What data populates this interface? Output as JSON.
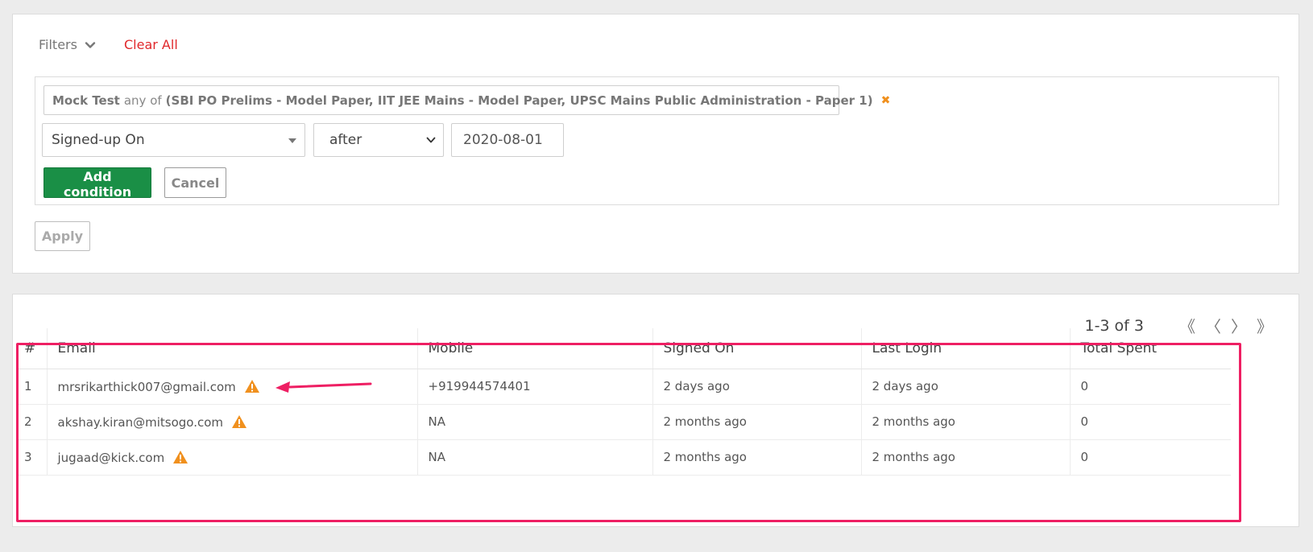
{
  "filters": {
    "toggle_label": "Filters",
    "clear_all_label": "Clear All",
    "condition_tag": {
      "field": "Mock Test",
      "operator": "any of",
      "values": "(SBI PO Prelims - Model Paper, IIT JEE Mains - Model Paper, UPSC Mains Public Administration - Paper 1)"
    },
    "new_condition": {
      "field": "Signed-up On",
      "operator": "after",
      "value": "2020-08-01"
    },
    "add_condition_label": "Add condition",
    "cancel_label": "Cancel",
    "apply_label": "Apply"
  },
  "pagination": {
    "info": "1-3 of 3",
    "first": "《",
    "prev": "〈",
    "next": "〉",
    "last": "》"
  },
  "table": {
    "headers": [
      "#",
      "Email",
      "Mobile",
      "Signed On",
      "Last Login",
      "Total Spent"
    ],
    "rows": [
      {
        "index": "1",
        "email": "mrsrikarthick007@gmail.com",
        "mobile": "+919944574401",
        "signed_on": "2 days ago",
        "last_login": "2 days ago",
        "total_spent": "0"
      },
      {
        "index": "2",
        "email": "akshay.kiran@mitsogo.com",
        "mobile": "NA",
        "signed_on": "2 months ago",
        "last_login": "2 months ago",
        "total_spent": "0"
      },
      {
        "index": "3",
        "email": "jugaad@kick.com",
        "mobile": "NA",
        "signed_on": "2 months ago",
        "last_login": "2 months ago",
        "total_spent": "0"
      }
    ]
  },
  "colors": {
    "primary_green": "#1a8f46",
    "danger_red": "#e0282b",
    "warning_orange": "#f0901e",
    "highlight_pink": "#ee1f63"
  },
  "icons": {
    "row_warning": "warning-triangle-icon",
    "tag_remove": "close-x-icon",
    "filters_toggle": "chevron-down-icon"
  }
}
